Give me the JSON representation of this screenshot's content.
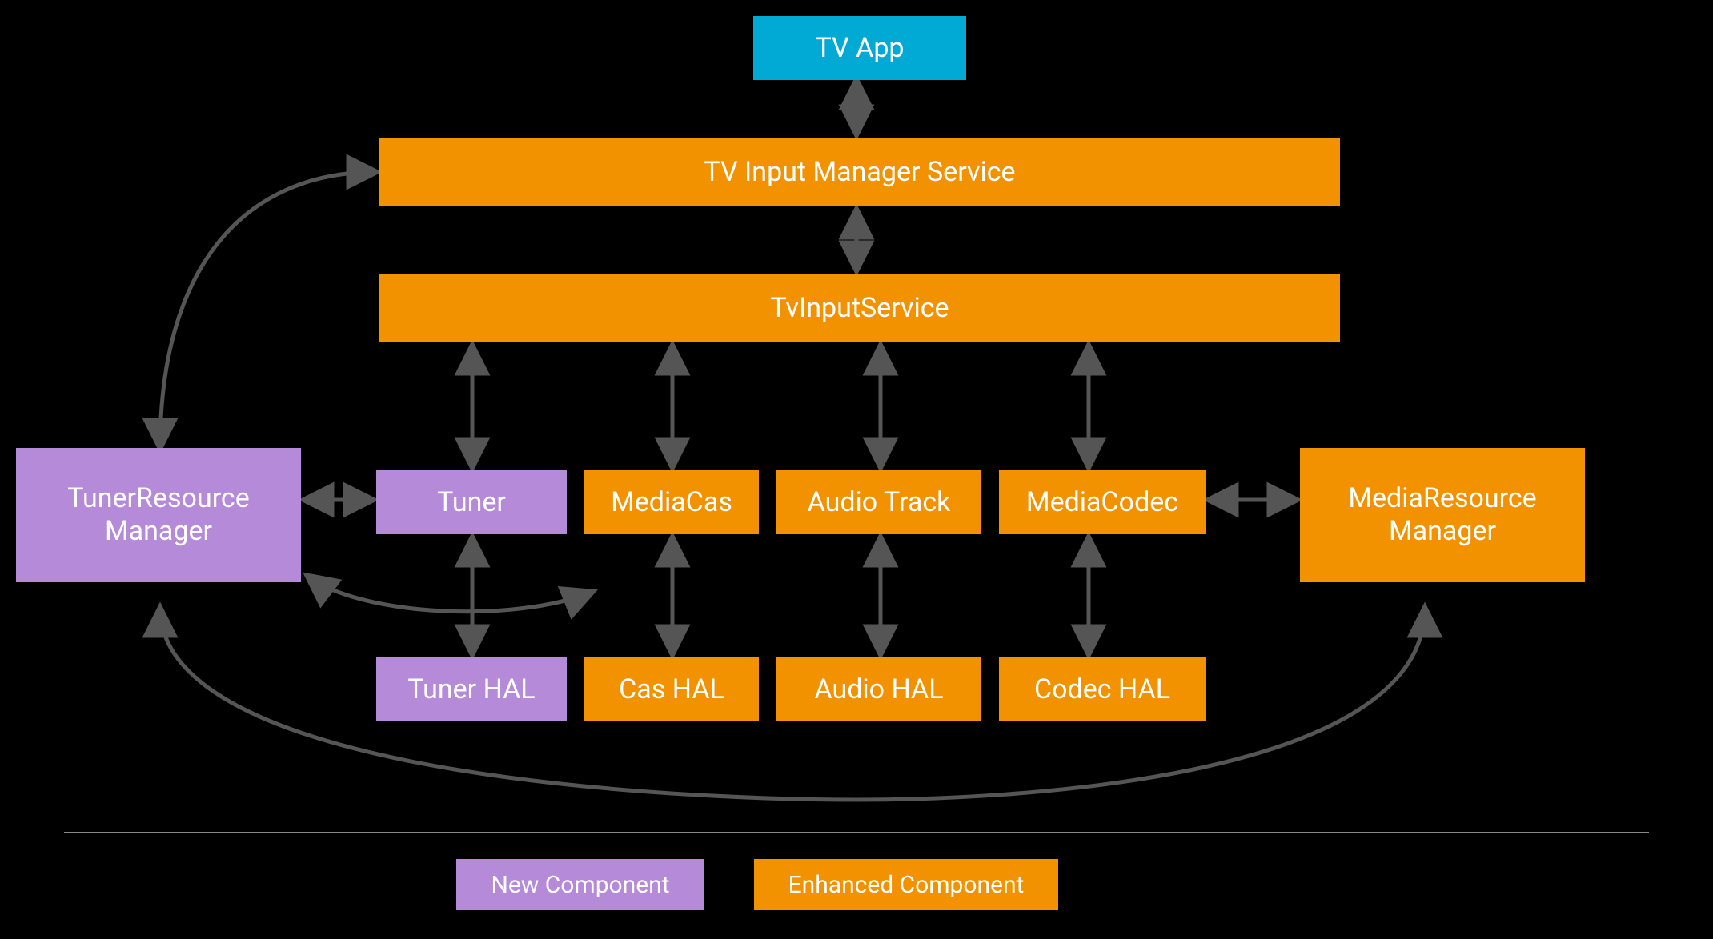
{
  "boxes": {
    "tv_app": "TV App",
    "tv_input_manager_service": "TV Input Manager Service",
    "tv_input_service": "TvInputService",
    "tuner": "Tuner",
    "media_cas": "MediaCas",
    "audio_track": "Audio Track",
    "media_codec": "MediaCodec",
    "tuner_hal": "Tuner HAL",
    "cas_hal": "Cas HAL",
    "audio_hal": "Audio HAL",
    "codec_hal": "Codec HAL",
    "tuner_resource_manager": "TunerResource\nManager",
    "media_resource_manager": "MediaResource\nManager"
  },
  "legend": {
    "new_component": "New Component",
    "enhanced_component": "Enhanced Component"
  },
  "colors": {
    "cyan": "#00aad4",
    "orange": "#f39200",
    "purple": "#b58ad8",
    "arrow": "#555555"
  }
}
